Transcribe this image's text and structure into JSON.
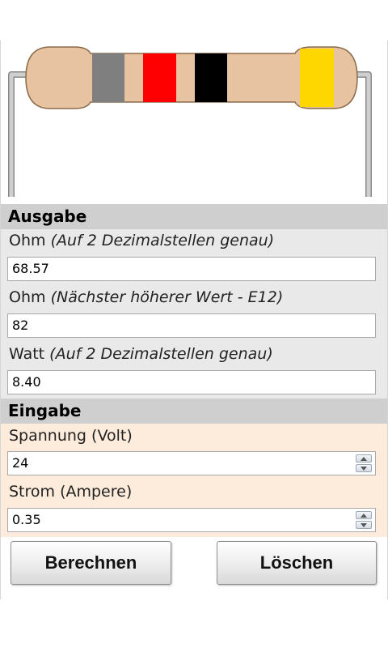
{
  "resistor": {
    "body_color": "#e8c3a1",
    "outline_color": "#8b6b4a",
    "lead_color": "#c9c9c9",
    "bands": [
      {
        "name": "band-1",
        "color": "#7f7f7f"
      },
      {
        "name": "band-2",
        "color": "#ff0000"
      },
      {
        "name": "band-3",
        "color": "#000000"
      },
      {
        "name": "band-tolerance",
        "color": "#ffd700"
      }
    ]
  },
  "output": {
    "header": "Ausgabe",
    "ohm_label": "Ohm",
    "ohm_hint": "(Auf 2 Dezimalstellen genau)",
    "ohm_value": "68.57",
    "e12_label": "Ohm",
    "e12_hint": "(Nächster höherer Wert - E12)",
    "e12_value": "82",
    "watt_label": "Watt",
    "watt_hint": "(Auf 2 Dezimalstellen genau)",
    "watt_value": "8.40"
  },
  "input": {
    "header": "Eingabe",
    "voltage_label": "Spannung (Volt)",
    "voltage_value": "24",
    "current_label": "Strom (Ampere)",
    "current_value": "0.35"
  },
  "buttons": {
    "calculate": "Berechnen",
    "clear": "Löschen"
  }
}
